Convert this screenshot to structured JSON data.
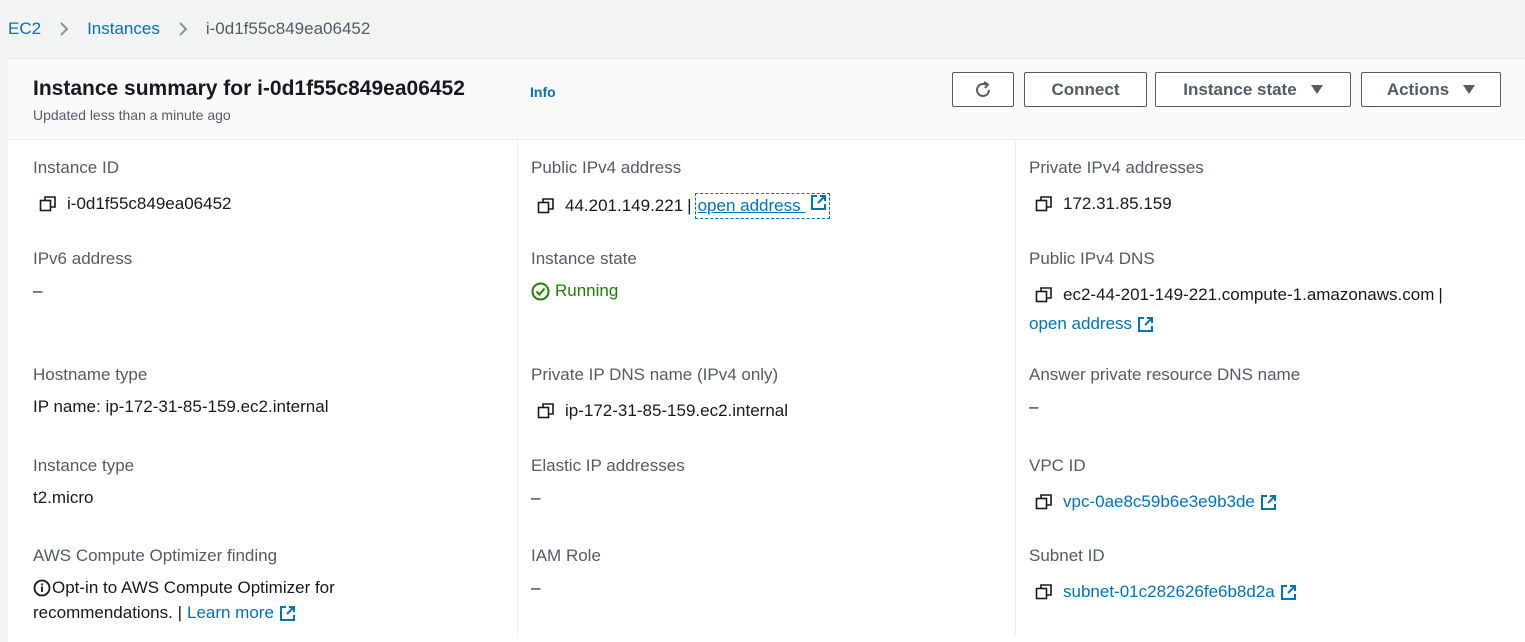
{
  "breadcrumb": {
    "items": [
      {
        "label": "EC2"
      },
      {
        "label": "Instances"
      },
      {
        "label": "i-0d1f55c849ea06452"
      }
    ]
  },
  "header": {
    "title": "Instance summary for i-0d1f55c849ea06452",
    "info": "Info",
    "subtitle": "Updated less than a minute ago",
    "buttons": {
      "connect": "Connect",
      "instance_state": "Instance state",
      "actions": "Actions"
    }
  },
  "fields": {
    "instance_id": {
      "label": "Instance ID",
      "value": "i-0d1f55c849ea06452"
    },
    "public_ipv4": {
      "label": "Public IPv4 address",
      "value": "44.201.149.221",
      "sep": "|",
      "link": "open address"
    },
    "private_ipv4": {
      "label": "Private IPv4 addresses",
      "value": "172.31.85.159"
    },
    "ipv6": {
      "label": "IPv6 address",
      "value": "–"
    },
    "instance_state": {
      "label": "Instance state",
      "value": "Running"
    },
    "public_dns": {
      "label": "Public IPv4 DNS",
      "value": "ec2-44-201-149-221.compute-1.amazonaws.com",
      "sep": "|",
      "link": "open address"
    },
    "hostname_type": {
      "label": "Hostname type",
      "value": "IP name: ip-172-31-85-159.ec2.internal"
    },
    "private_dns": {
      "label": "Private IP DNS name (IPv4 only)",
      "value": "ip-172-31-85-159.ec2.internal"
    },
    "answer_dns": {
      "label": "Answer private resource DNS name",
      "value": "–"
    },
    "instance_type": {
      "label": "Instance type",
      "value": "t2.micro"
    },
    "elastic_ip": {
      "label": "Elastic IP addresses",
      "value": "–"
    },
    "vpc_id": {
      "label": "VPC ID",
      "value": "vpc-0ae8c59b6e3e9b3de"
    },
    "optimizer": {
      "label": "AWS Compute Optimizer finding",
      "line1": "Opt-in to AWS Compute Optimizer for",
      "line2": "recommendations. |",
      "link": "Learn more"
    },
    "iam_role": {
      "label": "IAM Role",
      "value": "–"
    },
    "subnet_id": {
      "label": "Subnet ID",
      "value": "subnet-01c282626fe6b8d2a"
    }
  },
  "colors": {
    "link": "#0073bb",
    "running": "#1d8102",
    "label": "#545b64"
  }
}
